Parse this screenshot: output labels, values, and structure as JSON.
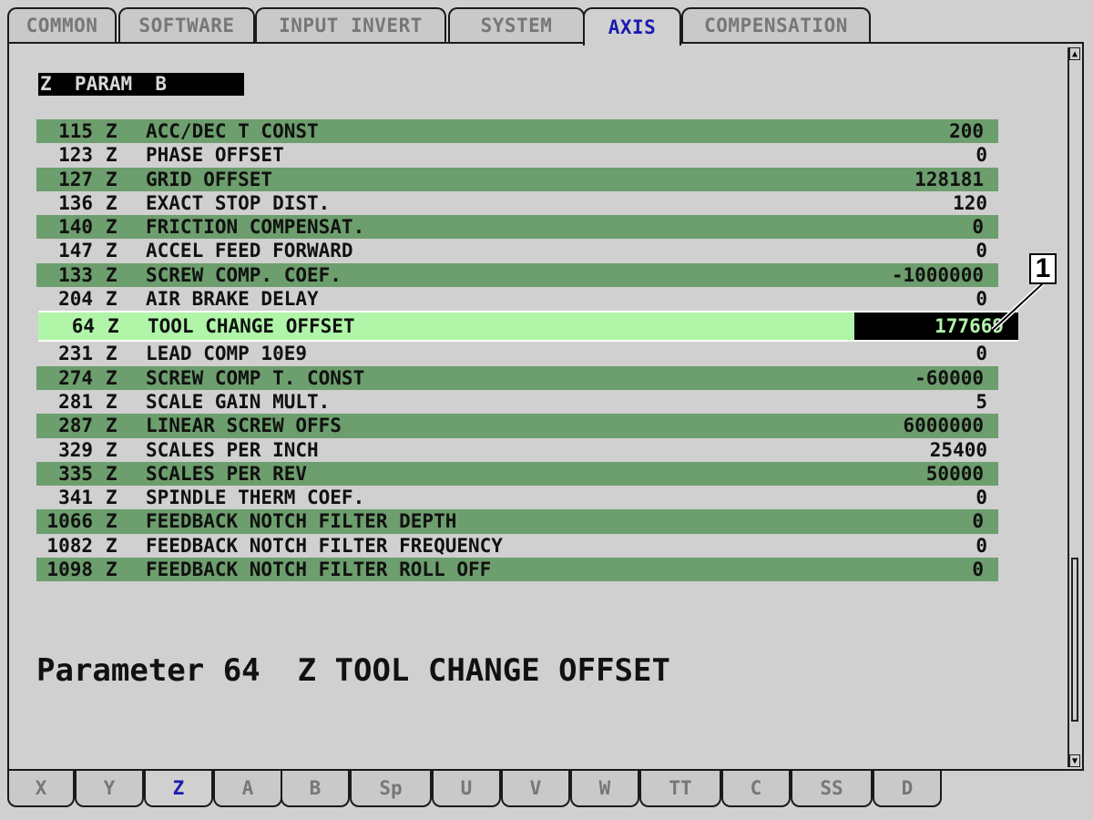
{
  "top_tabs": [
    {
      "label": "COMMON",
      "active": false
    },
    {
      "label": "SOFTWARE",
      "active": false
    },
    {
      "label": "INPUT INVERT",
      "active": false
    },
    {
      "label": "SYSTEM",
      "active": false
    },
    {
      "label": "AXIS",
      "active": true
    },
    {
      "label": "COMPENSATION",
      "active": false
    }
  ],
  "group_title": "Z  PARAM  B",
  "params": [
    {
      "num": "115",
      "axis": "Z",
      "name": "ACC/DEC T CONST",
      "value": "200"
    },
    {
      "num": "123",
      "axis": "Z",
      "name": "PHASE OFFSET",
      "value": "0"
    },
    {
      "num": "127",
      "axis": "Z",
      "name": "GRID OFFSET",
      "value": "128181"
    },
    {
      "num": "136",
      "axis": "Z",
      "name": "EXACT STOP DIST.",
      "value": "120"
    },
    {
      "num": "140",
      "axis": "Z",
      "name": "FRICTION COMPENSAT.",
      "value": "0"
    },
    {
      "num": "147",
      "axis": "Z",
      "name": "ACCEL FEED FORWARD",
      "value": "0"
    },
    {
      "num": "133",
      "axis": "Z",
      "name": "SCREW COMP. COEF.",
      "value": "-1000000"
    },
    {
      "num": "204",
      "axis": "Z",
      "name": "AIR BRAKE DELAY",
      "value": "0"
    },
    {
      "num": "64",
      "axis": "Z",
      "name": "TOOL CHANGE OFFSET",
      "value": "177669",
      "selected": true
    },
    {
      "num": "231",
      "axis": "Z",
      "name": "LEAD COMP 10E9",
      "value": "0"
    },
    {
      "num": "274",
      "axis": "Z",
      "name": "SCREW COMP T. CONST",
      "value": "-60000"
    },
    {
      "num": "281",
      "axis": "Z",
      "name": "SCALE GAIN MULT.",
      "value": "5"
    },
    {
      "num": "287",
      "axis": "Z",
      "name": "LINEAR SCREW OFFS",
      "value": "6000000"
    },
    {
      "num": "329",
      "axis": "Z",
      "name": "SCALES PER INCH",
      "value": "25400"
    },
    {
      "num": "335",
      "axis": "Z",
      "name": "SCALES PER REV",
      "value": "50000"
    },
    {
      "num": "341",
      "axis": "Z",
      "name": "SPINDLE THERM COEF.",
      "value": "0"
    },
    {
      "num": "1066",
      "axis": "Z",
      "name": "FEEDBACK NOTCH FILTER DEPTH",
      "value": "0"
    },
    {
      "num": "1082",
      "axis": "Z",
      "name": "FEEDBACK NOTCH FILTER FREQUENCY",
      "value": "0"
    },
    {
      "num": "1098",
      "axis": "Z",
      "name": "FEEDBACK NOTCH FILTER ROLL OFF",
      "value": "0"
    }
  ],
  "description": "Parameter 64  Z TOOL CHANGE OFFSET",
  "callout_label": "1",
  "bottom_tabs": [
    {
      "label": "X",
      "active": false
    },
    {
      "label": "Y",
      "active": false
    },
    {
      "label": "Z",
      "active": true
    },
    {
      "label": "A",
      "active": false
    },
    {
      "label": "B",
      "active": false
    },
    {
      "label": "Sp",
      "active": false
    },
    {
      "label": "U",
      "active": false
    },
    {
      "label": "V",
      "active": false
    },
    {
      "label": "W",
      "active": false
    },
    {
      "label": "TT",
      "active": false
    },
    {
      "label": "C",
      "active": false
    },
    {
      "label": "SS",
      "active": false
    },
    {
      "label": "D",
      "active": false
    }
  ],
  "colors": {
    "row_green": "#6d9e6d",
    "selected_row": "#b0f5a8",
    "active_tab_text": "#1a1ab0",
    "inactive_tab_text": "#777777"
  },
  "icons": {
    "scroll_up": "scroll-up-arrow-icon",
    "scroll_down": "scroll-down-arrow-icon"
  }
}
